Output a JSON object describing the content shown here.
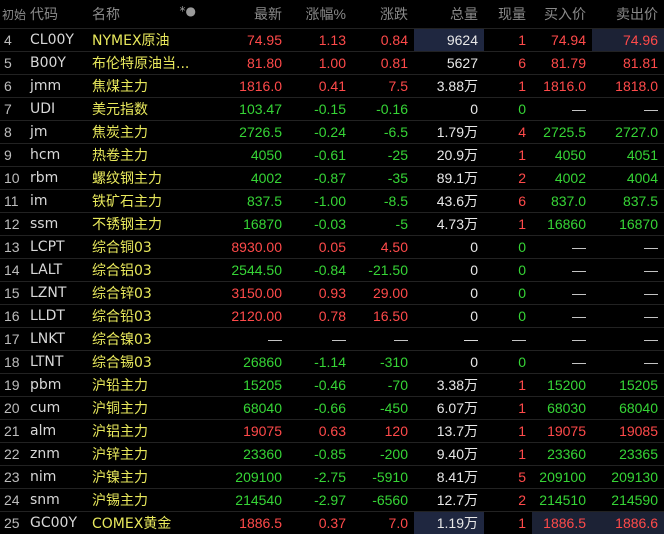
{
  "header": {
    "index": "初始",
    "code": "代码",
    "name": "名称",
    "star": "*●",
    "latest": "最新",
    "change_pct": "涨幅%",
    "change": "涨跌",
    "volume": "总量",
    "current_vol": "现量",
    "bid": "买入价",
    "ask": "卖出价"
  },
  "colors": {
    "background": "#000000",
    "up": "#ff4a4a",
    "down": "#36d536",
    "name": "#e8e85c",
    "highlight": "#1f2740"
  },
  "rows": [
    {
      "idx": "4",
      "code": "CL00Y",
      "name": "NYMEX原油",
      "latest": "74.95",
      "pct": "1.13",
      "chg": "0.84",
      "vol": "9624",
      "cur": "1",
      "bid": "74.94",
      "ask": "74.96",
      "dir": "up"
    },
    {
      "idx": "5",
      "code": "B00Y",
      "name": "布伦特原油当...",
      "latest": "81.80",
      "pct": "1.00",
      "chg": "0.81",
      "vol": "5627",
      "cur": "6",
      "bid": "81.79",
      "ask": "81.81",
      "dir": "up"
    },
    {
      "idx": "6",
      "code": "jmm",
      "name": "焦煤主力",
      "latest": "1816.0",
      "pct": "0.41",
      "chg": "7.5",
      "vol": "3.88万",
      "cur": "1",
      "bid": "1816.0",
      "ask": "1818.0",
      "dir": "up"
    },
    {
      "idx": "7",
      "code": "UDI",
      "name": "美元指数",
      "latest": "103.47",
      "pct": "-0.15",
      "chg": "-0.16",
      "vol": "0",
      "cur": "0",
      "bid": "—",
      "ask": "—",
      "dir": "down"
    },
    {
      "idx": "8",
      "code": "jm",
      "name": "焦炭主力",
      "latest": "2726.5",
      "pct": "-0.24",
      "chg": "-6.5",
      "vol": "1.79万",
      "cur": "4",
      "bid": "2725.5",
      "ask": "2727.0",
      "dir": "down"
    },
    {
      "idx": "9",
      "code": "hcm",
      "name": "热卷主力",
      "latest": "4050",
      "pct": "-0.61",
      "chg": "-25",
      "vol": "20.9万",
      "cur": "1",
      "bid": "4050",
      "ask": "4051",
      "dir": "down"
    },
    {
      "idx": "10",
      "code": "rbm",
      "name": "螺纹钢主力",
      "latest": "4002",
      "pct": "-0.87",
      "chg": "-35",
      "vol": "89.1万",
      "cur": "2",
      "bid": "4002",
      "ask": "4004",
      "dir": "down"
    },
    {
      "idx": "11",
      "code": "im",
      "name": "铁矿石主力",
      "latest": "837.5",
      "pct": "-1.00",
      "chg": "-8.5",
      "vol": "43.6万",
      "cur": "6",
      "bid": "837.0",
      "ask": "837.5",
      "dir": "down"
    },
    {
      "idx": "12",
      "code": "ssm",
      "name": "不锈钢主力",
      "latest": "16870",
      "pct": "-0.03",
      "chg": "-5",
      "vol": "4.73万",
      "cur": "1",
      "bid": "16860",
      "ask": "16870",
      "dir": "down"
    },
    {
      "idx": "13",
      "code": "LCPT",
      "name": "综合铜03",
      "latest": "8930.00",
      "pct": "0.05",
      "chg": "4.50",
      "vol": "0",
      "cur": "0",
      "bid": "—",
      "ask": "—",
      "dir": "up"
    },
    {
      "idx": "14",
      "code": "LALT",
      "name": "综合铝03",
      "latest": "2544.50",
      "pct": "-0.84",
      "chg": "-21.50",
      "vol": "0",
      "cur": "0",
      "bid": "—",
      "ask": "—",
      "dir": "down"
    },
    {
      "idx": "15",
      "code": "LZNT",
      "name": "综合锌03",
      "latest": "3150.00",
      "pct": "0.93",
      "chg": "29.00",
      "vol": "0",
      "cur": "0",
      "bid": "—",
      "ask": "—",
      "dir": "up"
    },
    {
      "idx": "16",
      "code": "LLDT",
      "name": "综合铅03",
      "latest": "2120.00",
      "pct": "0.78",
      "chg": "16.50",
      "vol": "0",
      "cur": "0",
      "bid": "—",
      "ask": "—",
      "dir": "up"
    },
    {
      "idx": "17",
      "code": "LNKT",
      "name": "综合镍03",
      "latest": "—",
      "pct": "—",
      "chg": "—",
      "vol": "—",
      "cur": "—",
      "bid": "—",
      "ask": "—",
      "dir": "none"
    },
    {
      "idx": "18",
      "code": "LTNT",
      "name": "综合锡03",
      "latest": "26860",
      "pct": "-1.14",
      "chg": "-310",
      "vol": "0",
      "cur": "0",
      "bid": "—",
      "ask": "—",
      "dir": "down"
    },
    {
      "idx": "19",
      "code": "pbm",
      "name": "沪铅主力",
      "latest": "15205",
      "pct": "-0.46",
      "chg": "-70",
      "vol": "3.38万",
      "cur": "1",
      "bid": "15200",
      "ask": "15205",
      "dir": "down"
    },
    {
      "idx": "20",
      "code": "cum",
      "name": "沪铜主力",
      "latest": "68040",
      "pct": "-0.66",
      "chg": "-450",
      "vol": "6.07万",
      "cur": "1",
      "bid": "68030",
      "ask": "68040",
      "dir": "down"
    },
    {
      "idx": "21",
      "code": "alm",
      "name": "沪铝主力",
      "latest": "19075",
      "pct": "0.63",
      "chg": "120",
      "vol": "13.7万",
      "cur": "1",
      "bid": "19075",
      "ask": "19085",
      "dir": "up"
    },
    {
      "idx": "22",
      "code": "znm",
      "name": "沪锌主力",
      "latest": "23360",
      "pct": "-0.85",
      "chg": "-200",
      "vol": "9.40万",
      "cur": "1",
      "bid": "23360",
      "ask": "23365",
      "dir": "down"
    },
    {
      "idx": "23",
      "code": "nim",
      "name": "沪镍主力",
      "latest": "209100",
      "pct": "-2.75",
      "chg": "-5910",
      "vol": "8.41万",
      "cur": "5",
      "bid": "209100",
      "ask": "209130",
      "dir": "down"
    },
    {
      "idx": "24",
      "code": "snm",
      "name": "沪锡主力",
      "latest": "214540",
      "pct": "-2.97",
      "chg": "-6560",
      "vol": "12.7万",
      "cur": "2",
      "bid": "214510",
      "ask": "214590",
      "dir": "down"
    },
    {
      "idx": "25",
      "code": "GC00Y",
      "name": "COMEX黄金",
      "latest": "1886.5",
      "pct": "0.37",
      "chg": "7.0",
      "vol": "1.19万",
      "cur": "1",
      "bid": "1886.5",
      "ask": "1886.6",
      "dir": "up"
    }
  ]
}
